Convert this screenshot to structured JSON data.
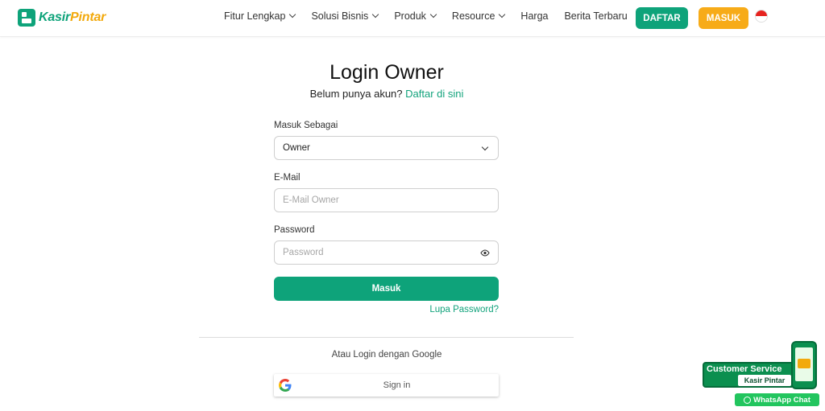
{
  "brand": {
    "name_part1": "Kasir",
    "name_part2": "Pintar",
    "color_primary": "#0ea37a",
    "color_accent": "#f7ab18"
  },
  "nav": {
    "items": [
      {
        "label": "Fitur Lengkap",
        "has_dropdown": true
      },
      {
        "label": "Solusi Bisnis",
        "has_dropdown": true
      },
      {
        "label": "Produk",
        "has_dropdown": true
      },
      {
        "label": "Resource",
        "has_dropdown": true
      },
      {
        "label": "Harga",
        "has_dropdown": false
      },
      {
        "label": "Berita Terbaru",
        "has_dropdown": false
      }
    ],
    "daftar_label": "DAFTAR",
    "masuk_label": "MASUK",
    "language_icon": "indonesia-flag-icon"
  },
  "login": {
    "title": "Login Owner",
    "subtitle_text": "Belum punya akun?",
    "subtitle_link": "Daftar di sini",
    "role_label": "Masuk Sebagai",
    "role_value": "Owner",
    "email_label": "E-Mail",
    "email_placeholder": "E-Mail Owner",
    "password_label": "Password",
    "password_placeholder": "Password",
    "submit_label": "Masuk",
    "forgot_label": "Lupa Password?",
    "alt_login_text": "Atau Login dengan Google",
    "google_signin_label": "Sign in"
  },
  "widget": {
    "title": "Customer Service",
    "subtitle": "Kasir Pintar",
    "whatsapp_label": "WhatsApp Chat"
  }
}
